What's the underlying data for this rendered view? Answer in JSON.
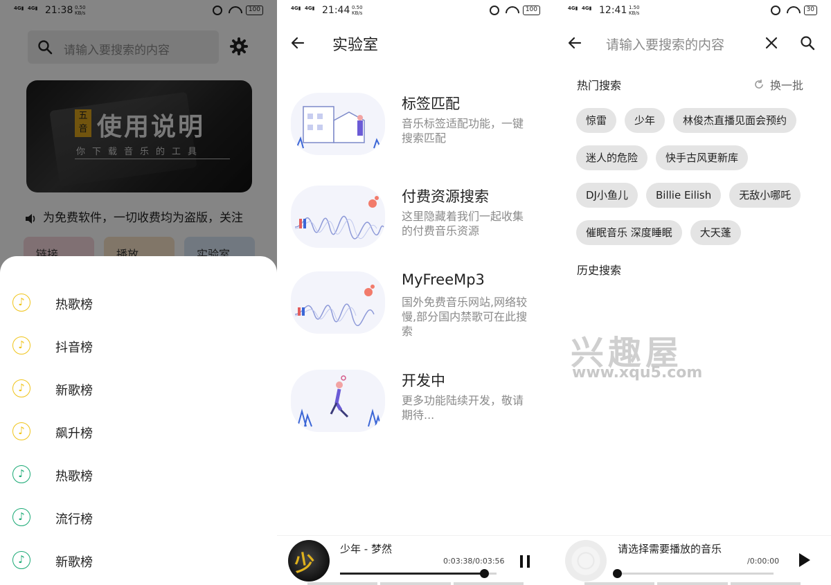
{
  "panel1": {
    "status": {
      "net": "4G",
      "time": "21:38",
      "speed": "0.50\nKB/s",
      "battery": "100"
    },
    "search_placeholder": "请输入要搜索的内容",
    "banner": {
      "badge": "五音",
      "title": "使用说明",
      "subtitle": "你下载音乐的工具"
    },
    "notice": "为免费软件，一切收费均为盗版，关注",
    "tiles": [
      {
        "label": "链接…",
        "color": "#f6d6dc"
      },
      {
        "label": "播放…",
        "color": "#f7e3c7"
      },
      {
        "label": "实验室",
        "color": "#d9e7f6"
      }
    ],
    "sheet_items": [
      {
        "label": "热歌榜",
        "tone": "yellow"
      },
      {
        "label": "抖音榜",
        "tone": "yellow"
      },
      {
        "label": "新歌榜",
        "tone": "yellow"
      },
      {
        "label": "飙升榜",
        "tone": "yellow"
      },
      {
        "label": "热歌榜",
        "tone": "green"
      },
      {
        "label": "流行榜",
        "tone": "green"
      },
      {
        "label": "新歌榜",
        "tone": "green"
      }
    ]
  },
  "panel2": {
    "status": {
      "net": "4G",
      "time": "21:44",
      "speed": "0.50\nKB/s",
      "battery": "100"
    },
    "title": "实验室",
    "items": [
      {
        "title": "标签匹配",
        "desc": "音乐标签适配功能，一键搜索匹配"
      },
      {
        "title": "付费资源搜索",
        "desc": "这里隐藏着我们一起收集的付费音乐资源"
      },
      {
        "title": "MyFreeMp3",
        "desc": "国外免费音乐网站,网络较慢,部分国内禁歌可在此搜索"
      },
      {
        "title": "开发中",
        "desc": "更多功能陆续开发，敬请期待..."
      }
    ],
    "player": {
      "song": "少年 - 梦然",
      "time": "0:03:38/0:03:56",
      "progress": 0.92,
      "cover_text": "少年"
    }
  },
  "panel3": {
    "status": {
      "net": "4G",
      "time": "12:41",
      "speed": "1.50\nKB/s",
      "battery": "30"
    },
    "search_placeholder": "请输入要搜索的内容",
    "hot_title": "热门搜索",
    "refresh_label": "换一批",
    "chips": [
      "惊雷",
      "少年",
      "林俊杰直播见面会预约",
      "迷人的危险",
      "快手古风更新库",
      "DJ小鱼儿",
      "Billie Eilish",
      "无敌小哪吒",
      "催眠音乐 深度睡眠",
      "大天蓬"
    ],
    "history_title": "历史搜索",
    "watermark": {
      "brand": "兴趣屋",
      "url": "www.xqu5.com"
    },
    "player": {
      "message": "请选择需要播放的音乐",
      "time": "/0:00:00",
      "progress": 0.0
    }
  }
}
